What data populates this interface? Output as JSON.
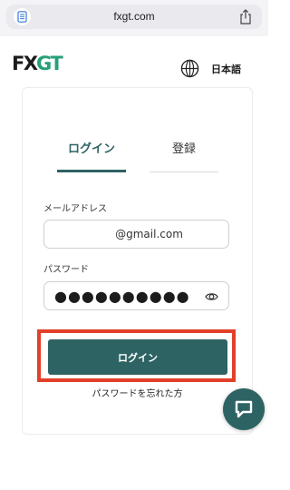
{
  "browser": {
    "url": "fxgt.com",
    "page_icon": "document-icon",
    "share_icon": "share-icon"
  },
  "header": {
    "logo_text": "FXGT",
    "language_icon": "globe-icon",
    "language_label": "日本語"
  },
  "login_card": {
    "tabs": [
      {
        "label": "ログイン",
        "active": true
      },
      {
        "label": "登録",
        "active": false
      }
    ],
    "email": {
      "label": "メールアドレス",
      "value": "@gmail.com"
    },
    "password": {
      "label": "パスワード",
      "value": "●●●●●●●●●●",
      "toggle_icon": "eye-icon"
    },
    "submit_label": "ログイン",
    "forgot_password": "パスワードを忘れた方"
  },
  "chat": {
    "icon": "chat-bubble-icon"
  },
  "colors": {
    "brand": "#2e6364",
    "logo_green": "#27a07a",
    "highlight": "#e2402a"
  }
}
